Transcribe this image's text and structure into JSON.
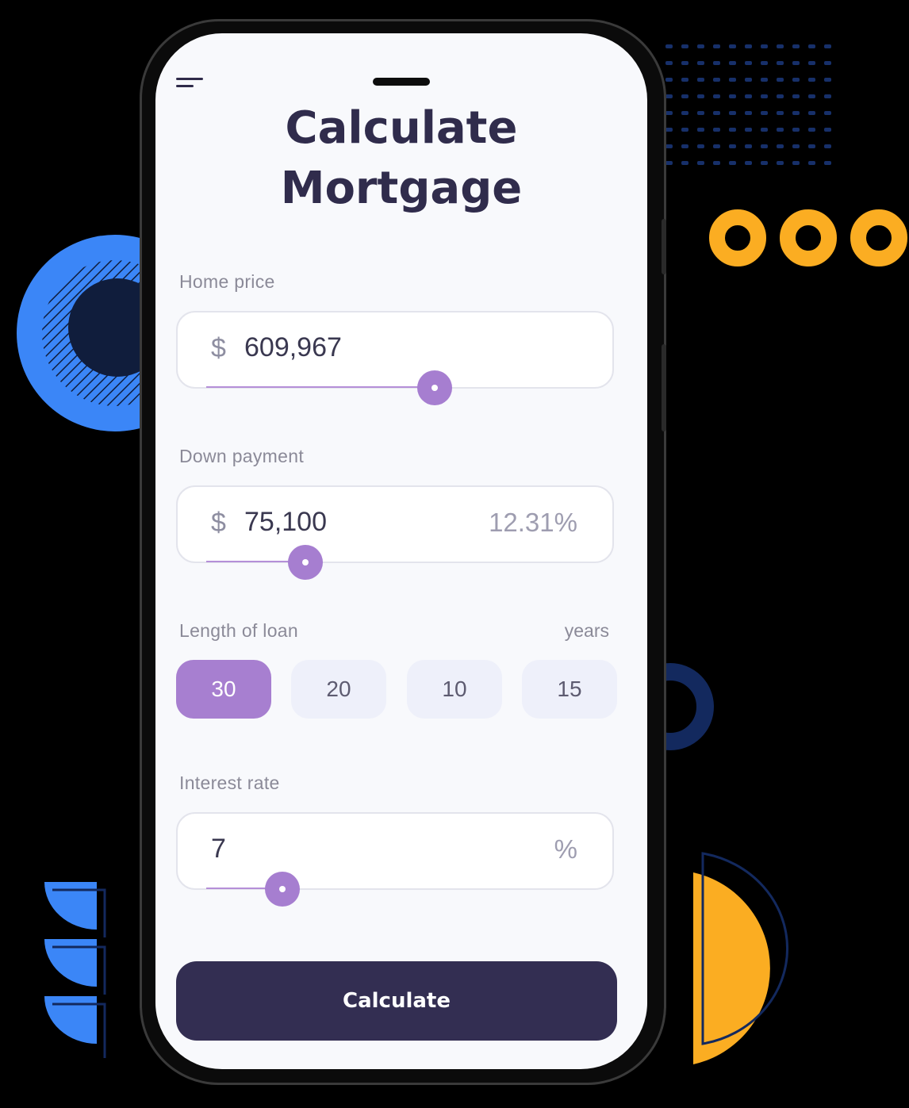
{
  "screen": {
    "title_line1": "Calculate",
    "title_line2": "Mortgage"
  },
  "home_price": {
    "label": "Home price",
    "currency": "$",
    "value": "609,967",
    "slider_fraction": 0.6
  },
  "down_payment": {
    "label": "Down payment",
    "currency": "$",
    "value": "75,100",
    "percent": "12.31%",
    "slider_fraction": 0.26
  },
  "loan_length": {
    "label": "Length of loan",
    "unit": "years",
    "options": [
      "30",
      "20",
      "10",
      "15"
    ],
    "selected": "30"
  },
  "interest_rate": {
    "label": "Interest rate",
    "value": "7",
    "unit": "%",
    "slider_fraction": 0.2
  },
  "actions": {
    "calculate_label": "Calculate"
  },
  "colors": {
    "accent": "#a67ed0",
    "button": "#332e52",
    "title": "#302c4c",
    "decor_blue": "#3b86f7",
    "decor_orange": "#fbad22",
    "decor_navy": "#13295e"
  }
}
